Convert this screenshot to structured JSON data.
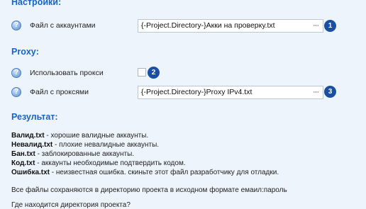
{
  "settings": {
    "title": "Настройки:",
    "accounts_label": "Файл с аккаунтами",
    "accounts_value": "{-Project.Directory-}Акки на проверку.txt",
    "accounts_badge": "1"
  },
  "proxy": {
    "title": "Proxy:",
    "use_label": "Использовать прокси",
    "use_checked": false,
    "use_badge": "2",
    "file_label": "Файл с проксями",
    "file_value": "{-Project.Directory-}Proxy IPv4.txt",
    "file_badge": "3"
  },
  "browse_label": "···",
  "help_glyph": "?",
  "results": {
    "title": "Результат:",
    "lines": [
      {
        "name": "Валид.txt",
        "desc": " - хорошие валидные аккаунты."
      },
      {
        "name": "Невалид.txt",
        "desc": " - плохие невалидные аккаунты."
      },
      {
        "name": "Бан.txt",
        "desc": " - заблокированные аккаунты."
      },
      {
        "name": "Код.txt",
        "desc": " - аккаунты необходимые подтвердить кодом."
      },
      {
        "name": "Ошибка.txt",
        "desc": " - неизвестная ошибка. скиньте этот файл разработчику для отладки."
      }
    ],
    "note": "Все файлы сохраняются в директорию проекта в исходном формате емаил:пароль",
    "question": "Где находится директория проекта?"
  },
  "colors": {
    "section_title": "#1565c8",
    "badge": "#1a4fa3",
    "background": "#eef4fb"
  }
}
